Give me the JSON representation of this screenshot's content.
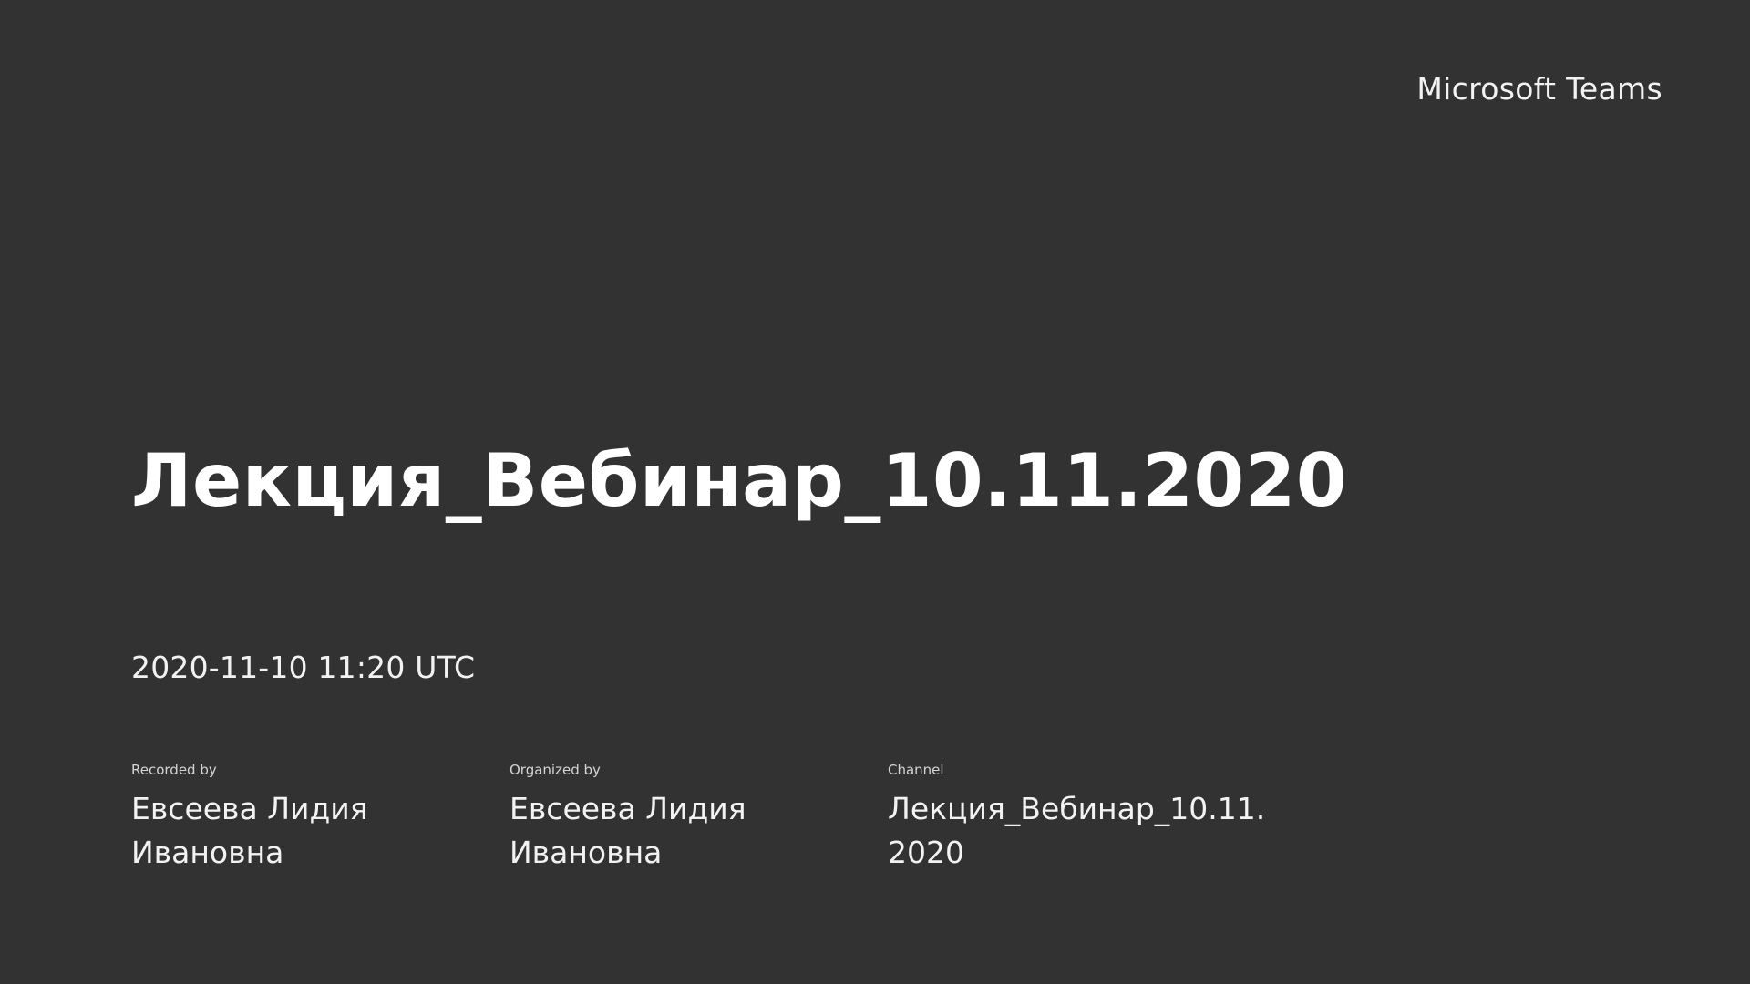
{
  "brand": {
    "name": "Microsoft Teams"
  },
  "recording": {
    "title": "Лекция_Вебинар_10.11.2020",
    "datetime": "2020-11-10 11:20 UTC"
  },
  "details": {
    "recorded_by": {
      "label": "Recorded by",
      "value": "Евсеева Лидия Ивановна"
    },
    "organized_by": {
      "label": "Organized by",
      "value": "Евсеева Лидия Ивановна"
    },
    "channel": {
      "label": "Channel",
      "value": "Лекция_Вебинар_10.11. 2020"
    }
  },
  "colors": {
    "background": "#323232",
    "text": "#ffffff"
  }
}
